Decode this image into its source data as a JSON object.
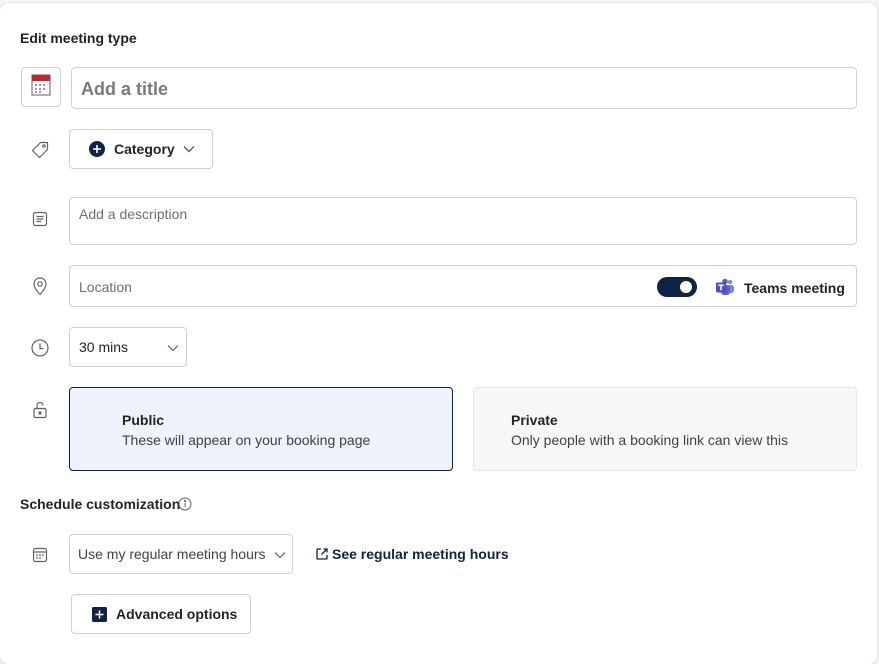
{
  "header": {
    "title": "Edit meeting type"
  },
  "title_field": {
    "placeholder": "Add a title",
    "value": ""
  },
  "category": {
    "label": "Category"
  },
  "description": {
    "placeholder": "Add a description",
    "value": ""
  },
  "location": {
    "placeholder": "Location",
    "value": "",
    "teams_toggle_on": true,
    "teams_label": "Teams meeting"
  },
  "duration": {
    "selected": "30 mins"
  },
  "visibility": {
    "selected": "public",
    "public": {
      "title": "Public",
      "subtitle": "These will appear on your booking page"
    },
    "private": {
      "title": "Private",
      "subtitle": "Only people with a booking link can view this"
    }
  },
  "schedule": {
    "heading": "Schedule customization",
    "hours_selected": "Use my regular meeting hours",
    "see_hours_link": "See regular meeting hours"
  },
  "advanced": {
    "label": "Advanced options"
  },
  "colors": {
    "accent_dark": "#0f2345",
    "selected_card_bg": "#edf2fb",
    "unselected_card_bg": "#f7f7f7",
    "teams_purple": "#5b5fc7",
    "calendar_red": "#c4262e"
  },
  "icons": [
    "calendar-icon",
    "tag-icon",
    "note-icon",
    "location-pin-icon",
    "clock-icon",
    "lock-open-icon",
    "calendar-grid-icon",
    "info-icon",
    "teams-icon",
    "open-external-icon",
    "plus-icon",
    "chevron-down-icon"
  ]
}
